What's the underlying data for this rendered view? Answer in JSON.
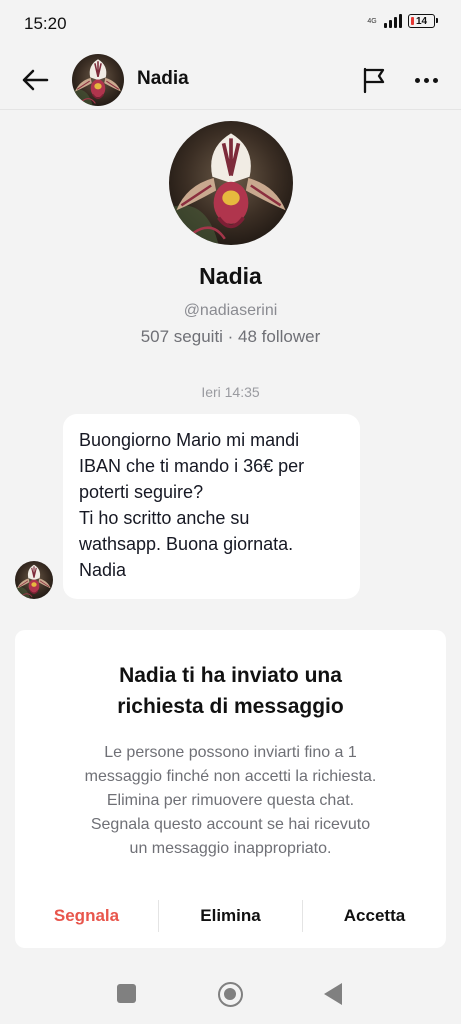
{
  "status_bar": {
    "time": "15:20",
    "network": "4G",
    "battery": "14",
    "battery_color": "#e53935"
  },
  "header": {
    "back_icon": "arrow-left-icon",
    "name": "Nadia",
    "flag_icon": "flag-icon",
    "more_icon": "more-horizontal-icon"
  },
  "profile": {
    "name": "Nadia",
    "handle": "@nadiaserini",
    "stats": "507 seguiti · 48 follower"
  },
  "conversation": {
    "timestamp": "Ieri 14:35",
    "message_lines": [
      "Buongiorno Mario mi mandi",
      "IBAN che ti mando i 36€ per",
      "poterti seguire?",
      "Ti ho scritto anche su",
      "wathsapp. Buona giornata.",
      "Nadia"
    ]
  },
  "request": {
    "title_lines": [
      "Nadia ti ha inviato una",
      "richiesta di messaggio"
    ],
    "description_lines": [
      "Le persone possono inviarti fino a 1",
      "messaggio finché non accetti la richiesta.",
      "Elimina per rimuovere questa chat.",
      "Segnala questo account se hai ricevuto",
      "un messaggio inappropriato."
    ],
    "report_label": "Segnala",
    "delete_label": "Elimina",
    "accept_label": "Accetta",
    "report_color": "#e8564c"
  },
  "nav": {
    "recents_icon": "square-icon",
    "home_icon": "circle-home-icon",
    "back_icon": "triangle-back-icon"
  }
}
